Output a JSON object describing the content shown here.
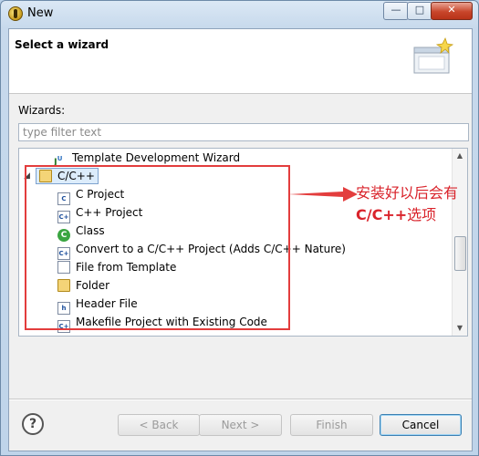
{
  "window": {
    "title": "New"
  },
  "header": {
    "title": "Select a wizard"
  },
  "wizards_label": "Wizards:",
  "filter": {
    "placeholder": "type filter text",
    "value": ""
  },
  "tree": {
    "items": [
      {
        "label": "Template Development Wizard",
        "icon": "template-wizard-icon"
      },
      {
        "label": "C/C++",
        "icon": "folder-open-icon",
        "expanded": true,
        "selected": true
      },
      {
        "label": "C Project",
        "icon": "c-project-icon"
      },
      {
        "label": "C++ Project",
        "icon": "cpp-project-icon"
      },
      {
        "label": "Class",
        "icon": "class-icon"
      },
      {
        "label": "Convert to a C/C++ Project (Adds C/C++ Nature)",
        "icon": "convert-icon"
      },
      {
        "label": "File from Template",
        "icon": "file-icon"
      },
      {
        "label": "Folder",
        "icon": "folder-icon"
      },
      {
        "label": "Header File",
        "icon": "header-file-icon"
      },
      {
        "label": "Makefile Project with Existing Code",
        "icon": "makefile-project-icon"
      }
    ]
  },
  "annotation": {
    "line1": "安装好以后会有",
    "line2a": "C/C++",
    "line2b": "选项",
    "color": "#d9232b"
  },
  "buttons": {
    "back": "< Back",
    "next": "Next >",
    "finish": "Finish",
    "cancel": "Cancel"
  },
  "help": "?",
  "colors": {
    "accent": "#3c7fb1",
    "annotation_red": "#e33d3d"
  }
}
